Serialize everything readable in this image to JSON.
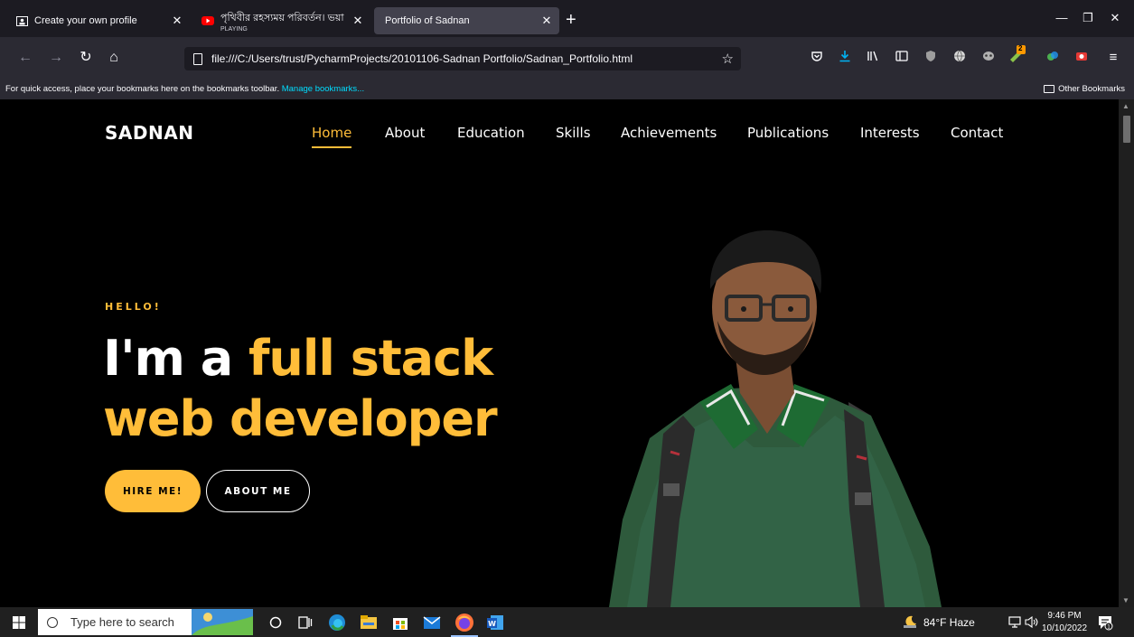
{
  "browser": {
    "tabs": [
      {
        "title": "Create your own profile",
        "active": false
      },
      {
        "title": "পৃথিবীর রহস্যময় পরিবর্তন। ভয়া",
        "subtitle": "PLAYING",
        "active": false
      },
      {
        "title": "Portfolio of Sadnan",
        "active": true
      }
    ],
    "url": "file:///C:/Users/trust/PycharmProjects/20101106-Sadnan Portfolio/Sadnan_Portfolio.html",
    "bookmarks_hint": "For quick access, place your bookmarks here on the bookmarks toolbar.",
    "bookmarks_link": "Manage bookmarks...",
    "other_bookmarks": "Other Bookmarks",
    "notification_badge": "2"
  },
  "page": {
    "logo": "SADNAN",
    "nav": [
      "Home",
      "About",
      "Education",
      "Skills",
      "Achievements",
      "Publications",
      "Interests",
      "Contact"
    ],
    "active_nav": "Home",
    "greeting": "HELLO!",
    "headline": {
      "prefix": "I'm a ",
      "highlight": "full stack",
      "line2": "web developer"
    },
    "hire_button": "HIRE ME!",
    "about_button": "ABOUT ME",
    "accent_color": "#ffbd39"
  },
  "taskbar": {
    "search_placeholder": "Type here to search",
    "weather": "84°F  Haze",
    "time": "9:46 PM",
    "date": "10/10/2022"
  }
}
